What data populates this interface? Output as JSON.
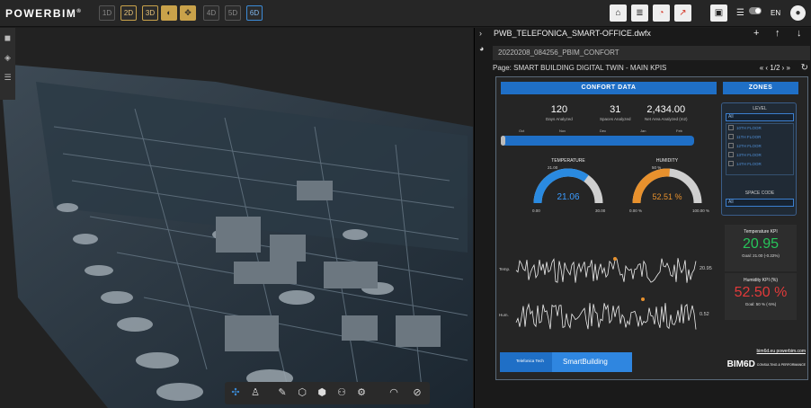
{
  "app": {
    "logo": "POWERBIM",
    "logo_mark": "®",
    "dimension_buttons": [
      "1D",
      "2D",
      "3D",
      "4D",
      "5D",
      "6D"
    ],
    "language": "EN",
    "toggle_label": "ON"
  },
  "panel": {
    "file_name": "PWB_TELEFONICA_SMART-OFFICE.dwfx",
    "view_name": "20220208_084256_PBIM_CONFORT",
    "page_label": "Page:",
    "page_title": "SMART BUILDING DIGITAL TWIN - MAIN KPIS",
    "page_indicator": "1/2"
  },
  "report": {
    "confort_title": "CONFORT DATA",
    "zones_title": "ZONES",
    "kpis": [
      {
        "value": "120",
        "label": "Days Analyzed"
      },
      {
        "value": "31",
        "label": "Spaces Analyzed"
      },
      {
        "value": "2,434.00",
        "label": "Net Area Analyzed (m2)"
      }
    ],
    "months": [
      "Oct",
      "Nov",
      "Dec",
      "Jan",
      "Feb"
    ],
    "temperature": {
      "title": "TEMPERATURE",
      "value": "21.06",
      "min": "0.00",
      "max": "30.00",
      "target": "21.00",
      "fill": 0.7
    },
    "humidity": {
      "title": "HUMIDITY",
      "value": "52.51 %",
      "min": "0.00 %",
      "max": "100.00 %",
      "target": "50 %",
      "fill": 0.5251
    },
    "temp_series_label": "Temp.",
    "hum_series_label": "Hum.",
    "temp_last": "20.95",
    "hum_last": "0.52",
    "zones": {
      "level_label": "LEVEL",
      "level_value": "All",
      "floors": [
        "10TH FLOOR",
        "11TH FLOOR",
        "12TH FLOOR",
        "13TH FLOOR",
        "14TH FLOOR"
      ],
      "space_code_label": "SPACE CODE",
      "space_code_value": "All"
    },
    "temp_kpi": {
      "title": "Temperature KPI",
      "value": "20.95",
      "goal": "Goal: 21.00 (-0.22%)",
      "color": "#27c45a"
    },
    "hum_kpi": {
      "title": "Humidity KPI (%)",
      "value": "52.50 %",
      "goal": "Goal: 50 % (-5%)",
      "color": "#e23a3a"
    },
    "footer": {
      "brand_left": "Telefonica Tech",
      "brand_right": "SmartBuilding",
      "links": "bim6d.eu  powerbim.com",
      "bim_logo": "BIM6D",
      "bim_tag": "CONSULTING & PERFORMANCE"
    }
  },
  "colors": {
    "accent_gold": "#c9a24a",
    "accent_blue": "#1f6fc6",
    "orange": "#e8912d"
  }
}
